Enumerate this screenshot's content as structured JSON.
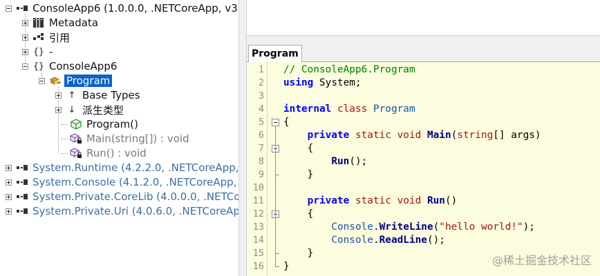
{
  "tree": {
    "root": "ConsoleApp6 (1.0.0.0, .NETCoreApp, v3",
    "metadata": "Metadata",
    "references": "引用",
    "empty_ns": "-",
    "namespace": "ConsoleApp6",
    "class": "Program",
    "base_types": "Base Types",
    "derived_types": "派生类型",
    "ctor": "Program()",
    "main": "Main(string[]) : void",
    "run": "Run() : void",
    "assemblies": [
      "System.Runtime (4.2.2.0, .NETCoreApp,",
      "System.Console (4.1.2.0, .NETCoreApp,",
      "System.Private.CoreLib (4.0.0.0, .NETCo",
      "System.Private.Uri (4.0.6.0, .NETCoreApp"
    ]
  },
  "editor": {
    "tab": "Program",
    "line_numbers": [
      "1",
      "2",
      "3",
      "4",
      "5",
      "6",
      "7",
      "8",
      "9",
      "10",
      "11",
      "12",
      "13",
      "14",
      "15",
      "16"
    ],
    "lines": {
      "l1": "// ConsoleApp6.Program",
      "l2_kw": "using",
      "l2_rest": " System;",
      "l4_kw": "internal",
      "l4_kw2": "class",
      "l4_typ": "Program",
      "l5": "{",
      "l6_kw": "private",
      "l6_kw2a": "static",
      "l6_kw2b": "void",
      "l6_fn": "Main",
      "l6_p1": "(",
      "l6_type": "string",
      "l6_p2": "[] args)",
      "l7": "{",
      "l8_fn": "Run",
      "l8_rest": "();",
      "l9": "}",
      "l11_kw": "private",
      "l11_kw2a": "static",
      "l11_kw2b": "void",
      "l11_fn": "Run",
      "l11_rest": "()",
      "l12": "{",
      "l13_typ": "Console",
      "l13_dot": ".",
      "l13_fn": "WriteLine",
      "l13_p1": "(",
      "l13_str": "\"hello world!\"",
      "l13_p2": ");",
      "l14_typ": "Console",
      "l14_dot": ".",
      "l14_fn": "ReadLine",
      "l14_rest": "();",
      "l15": "}",
      "l16": "}"
    }
  },
  "watermark": "@稀土掘金技术社区",
  "colors": {
    "selection": "#0a62c9",
    "editor_bg": "#fcfcde",
    "keyword": "#0000ff",
    "comment": "#008000"
  }
}
